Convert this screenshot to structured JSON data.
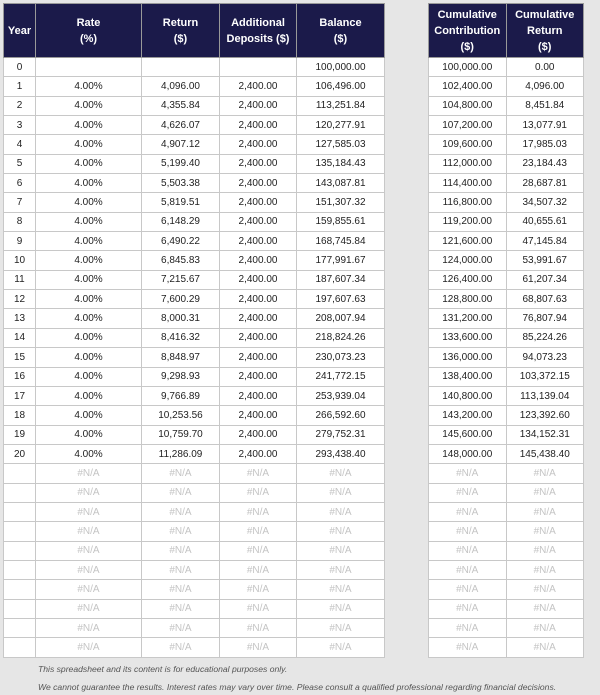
{
  "left_table": {
    "headers": [
      "Year",
      "Rate\n(%)",
      "Return\n($)",
      "Additional\nDeposits ($)",
      "Balance\n($)"
    ],
    "rows": [
      [
        "0",
        "",
        "",
        "",
        "100,000.00"
      ],
      [
        "1",
        "4.00%",
        "4,096.00",
        "2,400.00",
        "106,496.00"
      ],
      [
        "2",
        "4.00%",
        "4,355.84",
        "2,400.00",
        "113,251.84"
      ],
      [
        "3",
        "4.00%",
        "4,626.07",
        "2,400.00",
        "120,277.91"
      ],
      [
        "4",
        "4.00%",
        "4,907.12",
        "2,400.00",
        "127,585.03"
      ],
      [
        "5",
        "4.00%",
        "5,199.40",
        "2,400.00",
        "135,184.43"
      ],
      [
        "6",
        "4.00%",
        "5,503.38",
        "2,400.00",
        "143,087.81"
      ],
      [
        "7",
        "4.00%",
        "5,819.51",
        "2,400.00",
        "151,307.32"
      ],
      [
        "8",
        "4.00%",
        "6,148.29",
        "2,400.00",
        "159,855.61"
      ],
      [
        "9",
        "4.00%",
        "6,490.22",
        "2,400.00",
        "168,745.84"
      ],
      [
        "10",
        "4.00%",
        "6,845.83",
        "2,400.00",
        "177,991.67"
      ],
      [
        "11",
        "4.00%",
        "7,215.67",
        "2,400.00",
        "187,607.34"
      ],
      [
        "12",
        "4.00%",
        "7,600.29",
        "2,400.00",
        "197,607.63"
      ],
      [
        "13",
        "4.00%",
        "8,000.31",
        "2,400.00",
        "208,007.94"
      ],
      [
        "14",
        "4.00%",
        "8,416.32",
        "2,400.00",
        "218,824.26"
      ],
      [
        "15",
        "4.00%",
        "8,848.97",
        "2,400.00",
        "230,073.23"
      ],
      [
        "16",
        "4.00%",
        "9,298.93",
        "2,400.00",
        "241,772.15"
      ],
      [
        "17",
        "4.00%",
        "9,766.89",
        "2,400.00",
        "253,939.04"
      ],
      [
        "18",
        "4.00%",
        "10,253.56",
        "2,400.00",
        "266,592.60"
      ],
      [
        "19",
        "4.00%",
        "10,759.70",
        "2,400.00",
        "279,752.31"
      ],
      [
        "20",
        "4.00%",
        "11,286.09",
        "2,400.00",
        "293,438.40"
      ],
      [
        "",
        "#N/A",
        "#N/A",
        "#N/A",
        "#N/A"
      ],
      [
        "",
        "#N/A",
        "#N/A",
        "#N/A",
        "#N/A"
      ],
      [
        "",
        "#N/A",
        "#N/A",
        "#N/A",
        "#N/A"
      ],
      [
        "",
        "#N/A",
        "#N/A",
        "#N/A",
        "#N/A"
      ],
      [
        "",
        "#N/A",
        "#N/A",
        "#N/A",
        "#N/A"
      ],
      [
        "",
        "#N/A",
        "#N/A",
        "#N/A",
        "#N/A"
      ],
      [
        "",
        "#N/A",
        "#N/A",
        "#N/A",
        "#N/A"
      ],
      [
        "",
        "#N/A",
        "#N/A",
        "#N/A",
        "#N/A"
      ],
      [
        "",
        "#N/A",
        "#N/A",
        "#N/A",
        "#N/A"
      ],
      [
        "",
        "#N/A",
        "#N/A",
        "#N/A",
        "#N/A"
      ]
    ]
  },
  "right_table": {
    "headers": [
      "Cumulative\nContribution\n($)",
      "Cumulative\nReturn\n($)"
    ],
    "rows": [
      [
        "100,000.00",
        "0.00"
      ],
      [
        "102,400.00",
        "4,096.00"
      ],
      [
        "104,800.00",
        "8,451.84"
      ],
      [
        "107,200.00",
        "13,077.91"
      ],
      [
        "109,600.00",
        "17,985.03"
      ],
      [
        "112,000.00",
        "23,184.43"
      ],
      [
        "114,400.00",
        "28,687.81"
      ],
      [
        "116,800.00",
        "34,507.32"
      ],
      [
        "119,200.00",
        "40,655.61"
      ],
      [
        "121,600.00",
        "47,145.84"
      ],
      [
        "124,000.00",
        "53,991.67"
      ],
      [
        "126,400.00",
        "61,207.34"
      ],
      [
        "128,800.00",
        "68,807.63"
      ],
      [
        "131,200.00",
        "76,807.94"
      ],
      [
        "133,600.00",
        "85,224.26"
      ],
      [
        "136,000.00",
        "94,073.23"
      ],
      [
        "138,400.00",
        "103,372.15"
      ],
      [
        "140,800.00",
        "113,139.04"
      ],
      [
        "143,200.00",
        "123,392.60"
      ],
      [
        "145,600.00",
        "134,152.31"
      ],
      [
        "148,000.00",
        "145,438.40"
      ],
      [
        "#N/A",
        "#N/A"
      ],
      [
        "#N/A",
        "#N/A"
      ],
      [
        "#N/A",
        "#N/A"
      ],
      [
        "#N/A",
        "#N/A"
      ],
      [
        "#N/A",
        "#N/A"
      ],
      [
        "#N/A",
        "#N/A"
      ],
      [
        "#N/A",
        "#N/A"
      ],
      [
        "#N/A",
        "#N/A"
      ],
      [
        "#N/A",
        "#N/A"
      ],
      [
        "#N/A",
        "#N/A"
      ]
    ]
  },
  "footer": {
    "line1": "This spreadsheet and its content is for educational purposes only.",
    "line2": "We cannot guarantee the results. Interest rates may vary over time. Please consult a qualified professional regarding financial decisions."
  },
  "colors": {
    "header_bg": "#1b1a4a",
    "na_text": "#c4c4c4"
  }
}
